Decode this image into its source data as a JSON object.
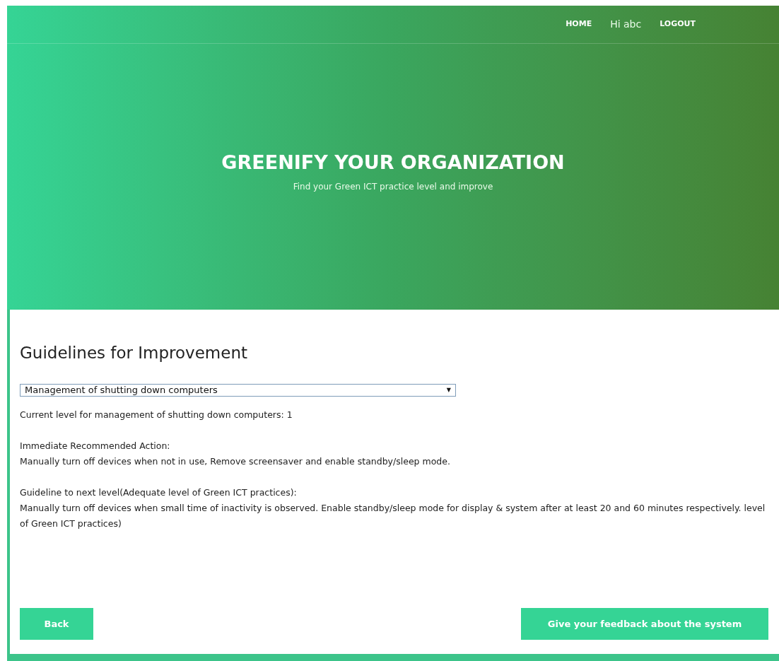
{
  "nav": [
    {
      "label": "HOME",
      "kind": "link"
    },
    {
      "label": "Hi abc",
      "kind": "greeting"
    },
    {
      "label": "LOGOUT",
      "kind": "link"
    }
  ],
  "hero": {
    "title": "GREENIFY YOUR ORGANIZATION",
    "subtitle": "Find your Green ICT practice level and improve"
  },
  "section": {
    "heading": "Guidelines for Improvement",
    "dropdown": {
      "value": "Management of shutting down computers",
      "arrow": "▼"
    },
    "paragraphs": [
      {
        "lines": [
          "Current level for management of shutting down computers: 1"
        ]
      },
      {
        "lines": [
          "Immediate Recommended Action:",
          "Manually turn off devices when not in use, Remove screensaver and enable standby/sleep mode."
        ]
      },
      {
        "lines": [
          "Guideline to next level(Adequate level of Green ICT practices):",
          "Manually turn off devices when small time of inactivity is observed. Enable standby/sleep mode for display & system after at least 20 and 60 minutes respectively.  level of Green ICT practices)"
        ]
      }
    ]
  },
  "buttons": [
    {
      "label": "Back"
    },
    {
      "label": "Give your feedback about the system"
    }
  ]
}
